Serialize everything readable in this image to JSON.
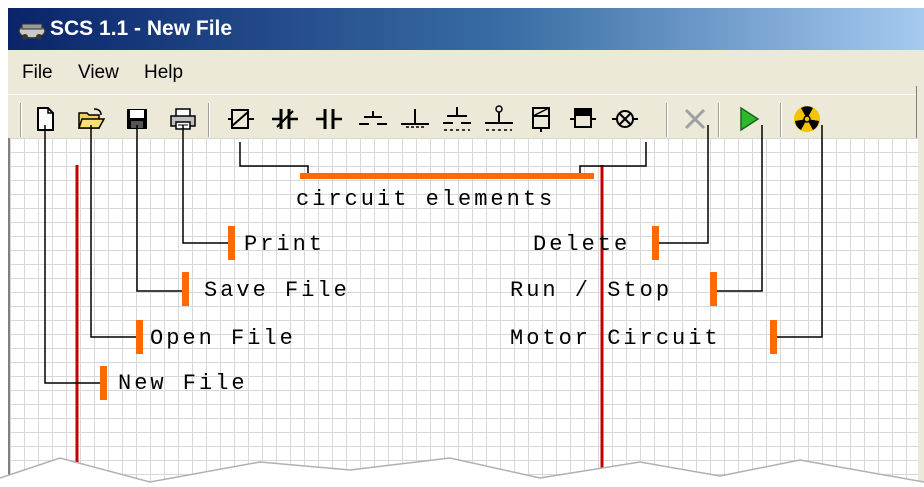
{
  "window": {
    "title": "SCS 1.1 - New File"
  },
  "menu": {
    "file": "File",
    "view": "View",
    "help": "Help"
  },
  "toolbar": {
    "buttons": [
      {
        "name": "new-file-button",
        "icon": "new-file-icon"
      },
      {
        "name": "open-file-button",
        "icon": "open-folder-icon"
      },
      {
        "name": "save-file-button",
        "icon": "floppy-disk-icon"
      },
      {
        "name": "print-button",
        "icon": "printer-icon"
      },
      {
        "name": "element-coil-button",
        "icon": "coil-icon"
      },
      {
        "name": "element-nc-contact-button",
        "icon": "normally-closed-contact-icon"
      },
      {
        "name": "element-no-contact-button",
        "icon": "normally-open-contact-icon"
      },
      {
        "name": "element-push-no-button",
        "icon": "pushbutton-no-icon"
      },
      {
        "name": "element-push-nc-button",
        "icon": "pushbutton-nc-icon"
      },
      {
        "name": "element-switch-no-button",
        "icon": "switch-no-icon"
      },
      {
        "name": "element-switch-nc-button",
        "icon": "switch-nc-icon"
      },
      {
        "name": "element-relay-button",
        "icon": "relay-icon"
      },
      {
        "name": "element-timer-button",
        "icon": "timer-relay-icon"
      },
      {
        "name": "element-lamp-button",
        "icon": "lamp-icon"
      },
      {
        "name": "delete-button",
        "icon": "delete-x-icon"
      },
      {
        "name": "run-stop-button",
        "icon": "play-icon"
      },
      {
        "name": "motor-circuit-button",
        "icon": "radiation-icon"
      }
    ]
  },
  "annotations": {
    "circuit_elements": "circuit elements",
    "print": "Print",
    "save_file": "Save File",
    "open_file": "Open File",
    "new_file": "New File",
    "delete": "Delete",
    "run_stop": "Run / Stop",
    "motor_circuit": "Motor Circuit"
  },
  "colors": {
    "accent": "#ff6a00",
    "rail": "#c00000",
    "title_start": "#0a246a",
    "title_end": "#a6caf0",
    "play": "#2db82d",
    "motor": "#f4c400"
  }
}
